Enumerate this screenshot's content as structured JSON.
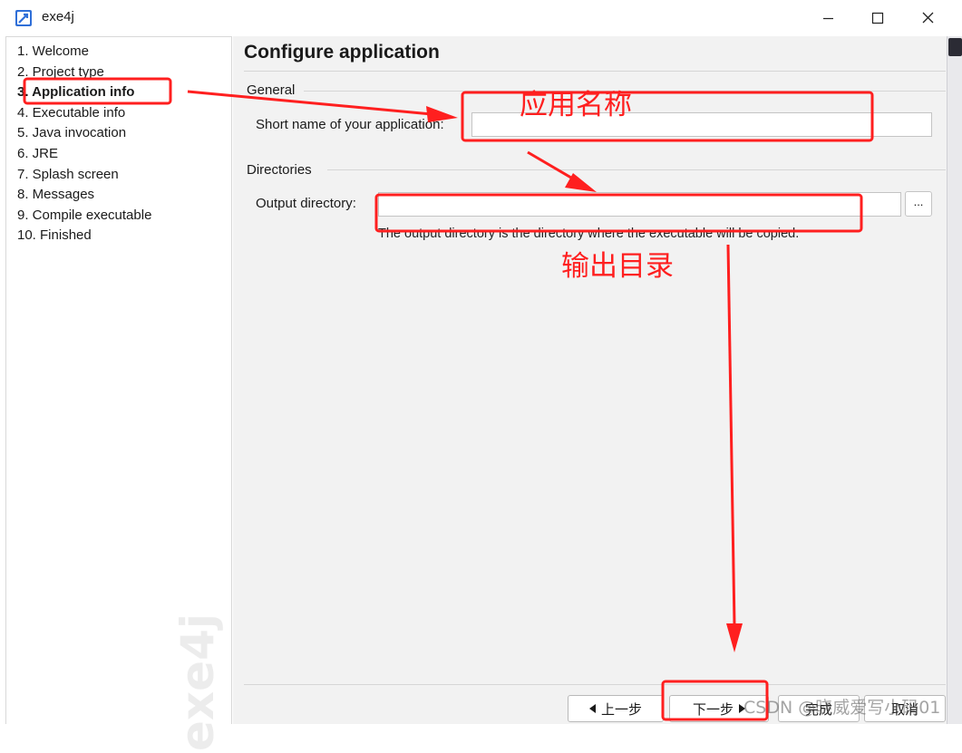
{
  "window": {
    "title": "exe4j",
    "icon": "exe4j-app-icon",
    "controls": [
      "minimize-icon",
      "maximize-icon",
      "close-icon"
    ]
  },
  "sidebar": {
    "steps": [
      {
        "label": "1. Welcome"
      },
      {
        "label": "2. Project type"
      },
      {
        "label": "3. Application info",
        "active": true
      },
      {
        "label": "4. Executable info"
      },
      {
        "label": "5. Java invocation"
      },
      {
        "label": "6. JRE"
      },
      {
        "label": "7. Splash screen"
      },
      {
        "label": "8. Messages"
      },
      {
        "label": "9. Compile executable"
      },
      {
        "label": "10. Finished"
      }
    ],
    "watermark": "exe4j"
  },
  "main": {
    "title": "Configure application",
    "general": {
      "label": "General",
      "short_name_label": "Short name of your application:",
      "short_name_value": ""
    },
    "directories": {
      "label": "Directories",
      "output_label": "Output directory:",
      "output_value": "",
      "browse_label": "...",
      "hint": "The output directory is the directory where the executable will be copied."
    },
    "buttons": {
      "prev": "上一步",
      "next": "下一步",
      "finish": "完成",
      "cancel": "取消"
    }
  },
  "annotations": {
    "app_name": "应用名称",
    "output_dir": "输出目录",
    "color": "#ff1f1f"
  },
  "watermark": {
    "csdn": "CSDN @晓威爱写小码01"
  }
}
